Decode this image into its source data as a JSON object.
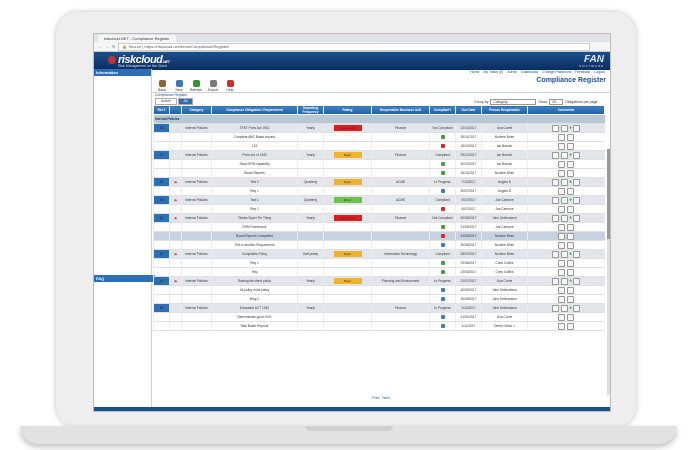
{
  "browser": {
    "tab_title": "riskcloud.NET - Compliance Register",
    "url": "https://riskcloud.net/demo/Compliance/Register/",
    "secure_label": "Secure"
  },
  "header": {
    "logo_text": "riskcloud",
    "logo_suffix": ".NET",
    "tagline": "Risk Management on the Cloud",
    "partner_logo": "FAN",
    "partner_sub": "SOFTWARE"
  },
  "sidebar": {
    "information_label": "Information",
    "faq_label": "FAQ"
  },
  "topnav": [
    "Home",
    "My Tasks (0)",
    "Admin",
    "Dashboard",
    "Change Password",
    "Feedback",
    "Logout"
  ],
  "toolbar": {
    "buttons": [
      {
        "label": "Back",
        "color": "#8a6a2a"
      },
      {
        "label": "New",
        "color": "#3a78c2"
      },
      {
        "label": "Refresh",
        "color": "#2a9b2a"
      },
      {
        "label": "Export",
        "color": "#7a7a7a"
      },
      {
        "label": "Help",
        "color": "#c9302c"
      }
    ],
    "page_title": "Compliance Register"
  },
  "breadcrumb": "Compliance Register",
  "filters": {
    "tabs": [
      {
        "label": "Active",
        "selected": false
      },
      {
        "label": "All",
        "selected": true
      }
    ],
    "group_by_label": "Group by",
    "group_by_value": "Category",
    "show_label": "Show",
    "show_value": "25",
    "per_page_label": "Obligations per page"
  },
  "table": {
    "columns": [
      "Ref #",
      "",
      "Category",
      "Compliance Obligation / Requirement",
      "Reporting Frequency",
      "Rating",
      "Responsible Business Unit",
      "Compliant?",
      "Due Date",
      "Person Responsible",
      "Comments"
    ],
    "group_label": "Internal Policies",
    "rows": [
      {
        "kind": "parent",
        "ref": "46",
        "flag": false,
        "category": "Internal Policies",
        "obligation": "TEST Ports Act 1942",
        "freq": "Yearly",
        "rating": "Catastrophic",
        "unit": "Finance",
        "compliant": "Not Compliant",
        "status": "",
        "due": "22/10/2017",
        "person": "Lisa Currie"
      },
      {
        "kind": "child",
        "obligation": "Complete ABC Board reports",
        "status": "green",
        "due": "30/11/2017",
        "person": "Norlene Brien"
      },
      {
        "kind": "child",
        "obligation": "123",
        "status": "red",
        "due": "18/10/2017",
        "person": "Ian Branch"
      },
      {
        "kind": "parent",
        "ref": "47",
        "flag": false,
        "category": "Internal Policies",
        "obligation": "Ports Act of 1942",
        "freq": "Yearly",
        "rating": "Major",
        "unit": "Finance",
        "compliant": "Compliant",
        "status": "",
        "due": "29/12/2017",
        "person": "Ian Branch"
      },
      {
        "kind": "child",
        "obligation": "Show ERM capability",
        "status": "green",
        "due": "30/10/2017",
        "person": "Ian Branch"
      },
      {
        "kind": "child",
        "obligation": "Board Reports",
        "status": "green",
        "due": "30/11/2017",
        "person": "Norlene Brien"
      },
      {
        "kind": "parent",
        "ref": "46",
        "flag": true,
        "category": "Internal Policies",
        "obligation": "Test 2",
        "freq": "Quarterly",
        "rating": "Major",
        "unit": "ACME",
        "compliant": "In Progress",
        "status": "",
        "due": "7/12/2017",
        "person": "Angela D"
      },
      {
        "kind": "child",
        "obligation": "Req 1",
        "status": "blue",
        "due": "30/07/2017",
        "person": "Angela D"
      },
      {
        "kind": "parent",
        "ref": "45",
        "flag": true,
        "category": "Internal Policies",
        "obligation": "Test 1",
        "freq": "Quarterly",
        "rating": "Minor",
        "unit": "ACME",
        "compliant": "Compliant",
        "status": "",
        "due": "5/07/2017",
        "person": "Joe Carbone"
      },
      {
        "kind": "child",
        "obligation": "Req 1",
        "status": "red",
        "due": "4/07/2017",
        "person": "Joe Carbone"
      },
      {
        "kind": "parent",
        "ref": "44",
        "flag": true,
        "category": "Internal Policies",
        "obligation": "Telstra Super Fin Thing",
        "freq": "Yearly",
        "rating": "Catastrophic",
        "unit": "Finance",
        "compliant": "Not Compliant",
        "status": "",
        "due": "30/06/2017",
        "person": "John Delimanium"
      },
      {
        "kind": "child",
        "obligation": "ERM Framework",
        "status": "green",
        "due": "31/05/2017",
        "person": "Joe Carbone"
      },
      {
        "kind": "highlight",
        "obligation": "Board Reports Completed",
        "status": "red",
        "due": "31/05/2017",
        "person": "Norlene Brien"
      },
      {
        "kind": "child",
        "obligation": "This is another Requirement",
        "status": "blue",
        "due": "30/06/2017",
        "person": "Norlene Brien"
      },
      {
        "kind": "parent",
        "ref": "42",
        "flag": true,
        "category": "Internal Policies",
        "obligation": "Complaints Policy",
        "freq": "Half yearly",
        "rating": "Major",
        "unit": "Information Technology",
        "compliant": "Compliant",
        "status": "",
        "due": "28/07/2017",
        "person": "Norlene Brien"
      },
      {
        "kind": "child",
        "obligation": "Req 1",
        "status": "green",
        "due": "29/06/2017",
        "person": "Chris Collins"
      },
      {
        "kind": "child",
        "obligation": "Req",
        "status": "green",
        "due": "23/03/2017",
        "person": "Chris Collins"
      },
      {
        "kind": "parent",
        "ref": "41",
        "flag": true,
        "category": "Internal Policies",
        "obligation": "Raising fair client policy",
        "freq": "Yearly",
        "rating": "Major",
        "unit": "Planning and Environment",
        "compliant": "In Progress",
        "status": "",
        "due": "21/07/2017",
        "person": "Lisa Currie"
      },
      {
        "kind": "child",
        "obligation": "All policy most policy",
        "status": "blue",
        "due": "30/09/2017",
        "person": "John Delimanium"
      },
      {
        "kind": "child",
        "obligation": "Blog 2",
        "status": "blue",
        "due": "30/09/2017",
        "person": "John Delimanium"
      },
      {
        "kind": "parent",
        "ref": "39",
        "flag": false,
        "category": "Internal Policies",
        "obligation": "Education ACT 1940",
        "freq": "Yearly",
        "rating": "",
        "unit": "Finance",
        "compliant": "In Progress",
        "status": "",
        "due": "1/12/2017",
        "person": "John Delimanium"
      },
      {
        "kind": "child",
        "obligation": "Demonstrate good OHS",
        "status": "blue",
        "due": "31/01/2017",
        "person": "Lisa Currie"
      },
      {
        "kind": "child",
        "obligation": "Risk Board Reports",
        "status": "blue",
        "due": "1/11/2017",
        "person": "Derek Gemo 1"
      }
    ]
  },
  "pager": {
    "prev": "Prev",
    "next": "Next"
  },
  "colors": {
    "catastrophic": "#e21b1b",
    "major": "#f0b429",
    "minor": "#6cc24a",
    "green": "#3aa53a",
    "red": "#d32a2a",
    "blue": "#3b7cc4"
  }
}
